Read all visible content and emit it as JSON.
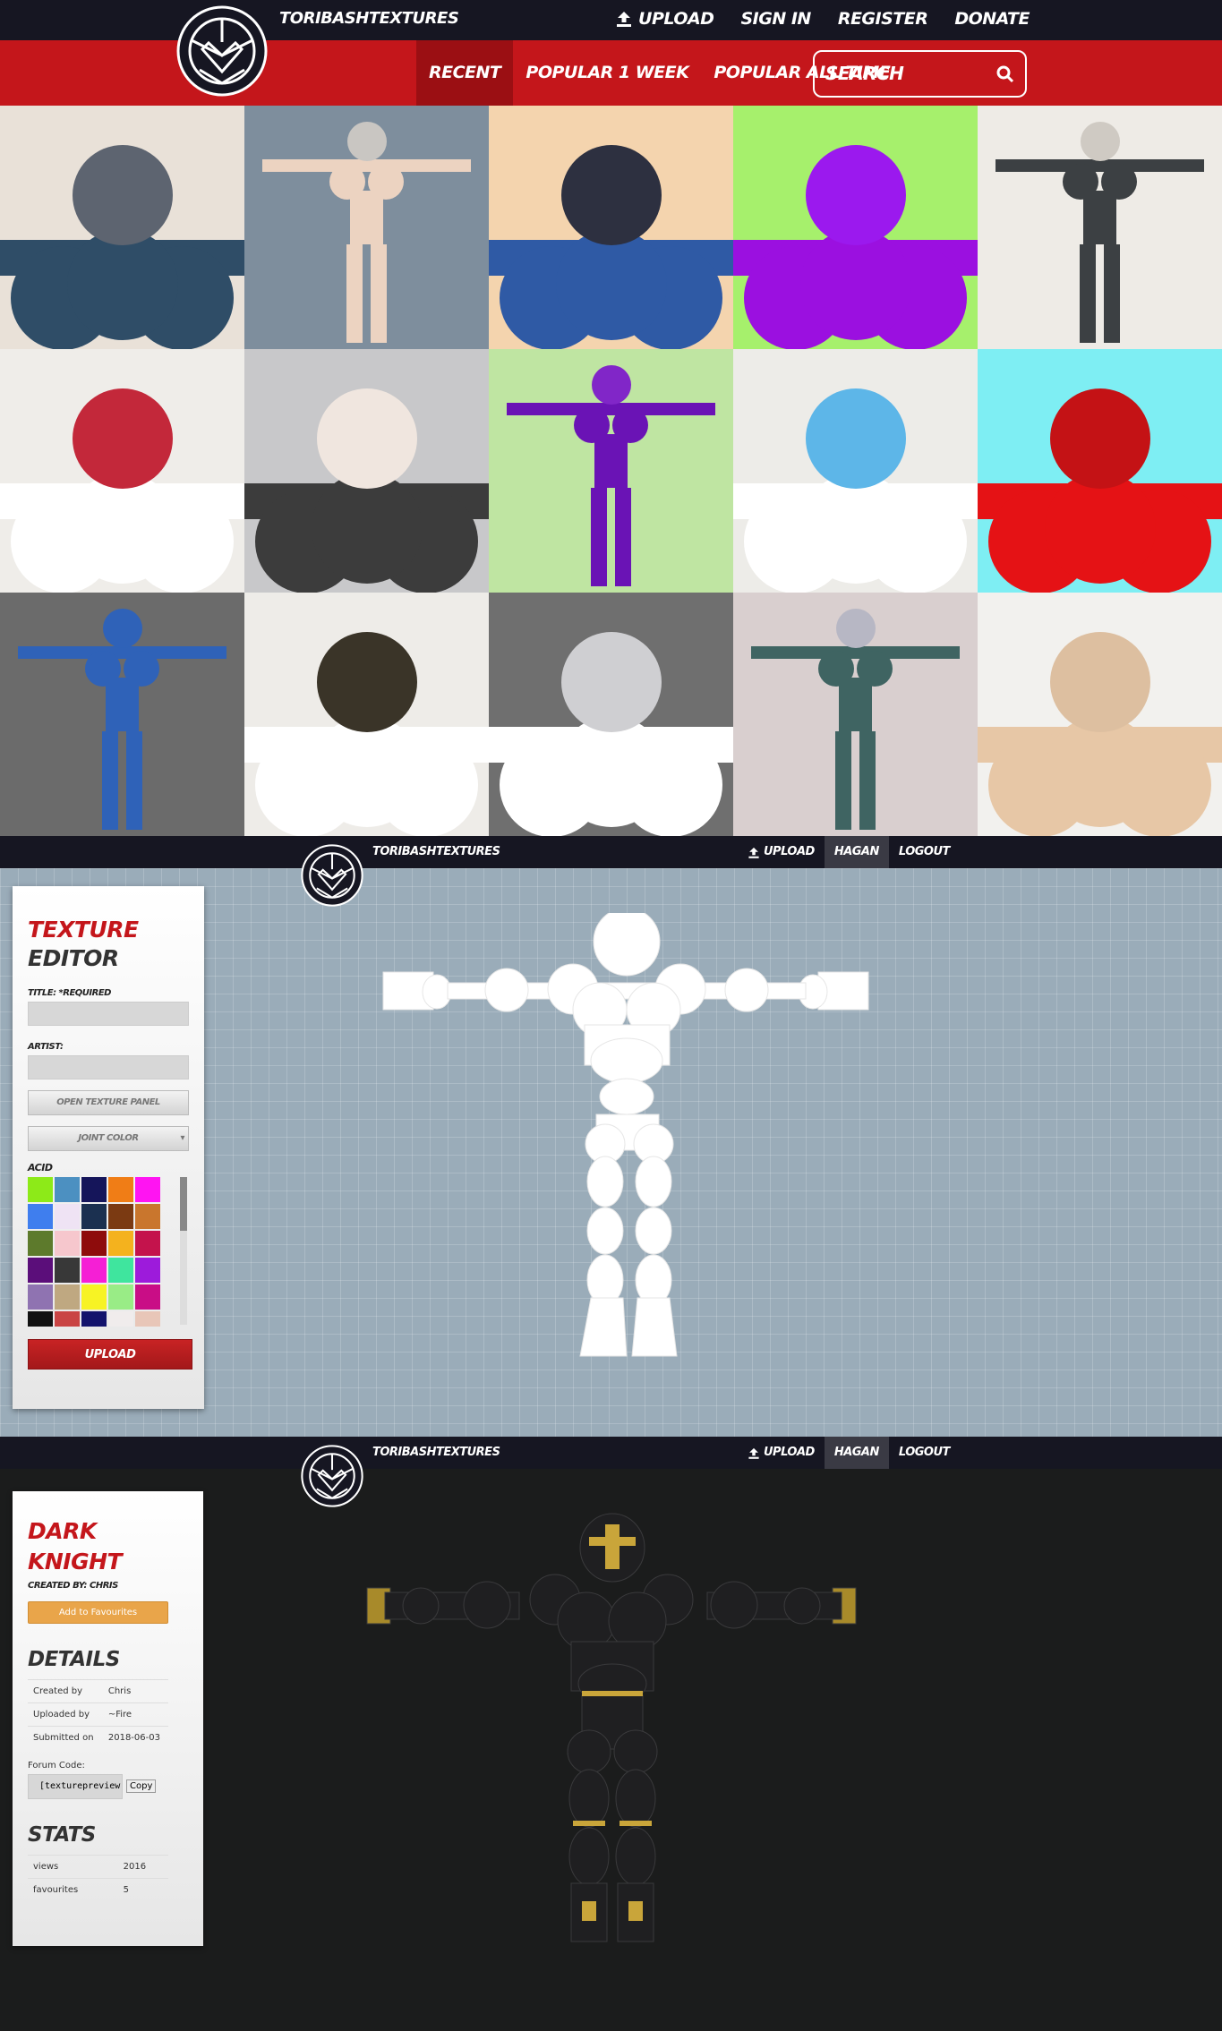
{
  "site": {
    "name": "TORIBASHTEXTURES",
    "top_links": [
      "UPLOAD",
      "SIGN IN",
      "REGISTER",
      "DONATE"
    ],
    "tabs": [
      "RECENT",
      "POPULAR 1 WEEK",
      "POPULAR ALL TIME"
    ],
    "active_tab": "RECENT",
    "search_placeholder": "SEARCH",
    "logged_in_links": {
      "upload": "UPLOAD",
      "user": "HAGAN",
      "logout": "LOGOUT"
    }
  },
  "gallery": {
    "tiles": [
      {
        "bg": "#e9e1d8",
        "body": "#2f4d67",
        "head": "#5d6470"
      },
      {
        "bg": "#7e8e9d",
        "body": "#ecd3c1",
        "head": "#c9c6c2"
      },
      {
        "bg": "#f4d4ae",
        "body": "#2f5aa5",
        "head": "#2d3040"
      },
      {
        "bg": "#a6f06c",
        "body": "#9b10e0",
        "head": "#9b19ee"
      },
      {
        "bg": "#eeebe6",
        "body": "#3c4043",
        "head": "#cfcac3"
      },
      {
        "bg": "#efede9",
        "body": "#ffffff",
        "head": "#c3283a"
      },
      {
        "bg": "#c8c8ca",
        "body": "#3c3c3c",
        "head": "#f0e6df"
      },
      {
        "bg": "#bfe5a2",
        "body": "#6a13b5",
        "head": "#8126c8"
      },
      {
        "bg": "#edece8",
        "body": "#ffffff",
        "head": "#5db6e8"
      },
      {
        "bg": "#7eeef3",
        "body": "#e51215",
        "head": "#c41215"
      },
      {
        "bg": "#6b6b6b",
        "body": "#2f62b8",
        "head": "#2f62b8"
      },
      {
        "bg": "#eeece8",
        "body": "#ffffff",
        "head": "#3a3428"
      },
      {
        "bg": "#6f6f6f",
        "body": "#ffffff",
        "head": "#cfcfd2"
      },
      {
        "bg": "#d9cfcf",
        "body": "#3f6462",
        "head": "#b7b7c4"
      },
      {
        "bg": "#f2f1ee",
        "body": "#e7c7a6",
        "head": "#ddbfa0"
      }
    ]
  },
  "editor": {
    "title_line1": "TEXTURE",
    "title_line2": "EDITOR",
    "title_label": "TITLE: *REQUIRED",
    "artist_label": "ARTIST:",
    "open_panel_button": "OPEN TEXTURE PANEL",
    "joint_color_select": "JOINT COLOR",
    "palette_name": "ACID",
    "palette": [
      "#8dea18",
      "#4c90c1",
      "#15155a",
      "#f07d16",
      "#ff14f2",
      "#3f7eee",
      "#efe3f4",
      "#1b3050",
      "#7b3a12",
      "#c9762d",
      "#5d7a2c",
      "#f6c7cd",
      "#8e0c0c",
      "#f4b21e",
      "#c4134c",
      "#5b0e7a",
      "#383838",
      "#f51fd5",
      "#3fe59e",
      "#9d1bdb",
      "#8f73b1",
      "#bfa881",
      "#f7f324",
      "#99ec86",
      "#c90d86",
      "#111111",
      "#c94444",
      "#13136c",
      "#f0ecec",
      "#e8c6b8"
    ],
    "upload_button": "UPLOAD"
  },
  "detail": {
    "title": "DARK KNIGHT",
    "created_by": "CREATED BY: CHRIS",
    "favourite_button": "Add to Favourites",
    "details_heading": "DETAILS",
    "details": [
      {
        "key": "Created by",
        "value": "Chris"
      },
      {
        "key": "Uploaded by",
        "value": "~Fire"
      },
      {
        "key": "Submitted on",
        "value": "2018-06-03"
      }
    ],
    "forum_code_label": "Forum Code:",
    "forum_code_value": "[texturepreview",
    "copy_button": "Copy",
    "stats_heading": "STATS",
    "stats": [
      {
        "key": "views",
        "value": "2016"
      },
      {
        "key": "favourites",
        "value": "5"
      }
    ]
  }
}
